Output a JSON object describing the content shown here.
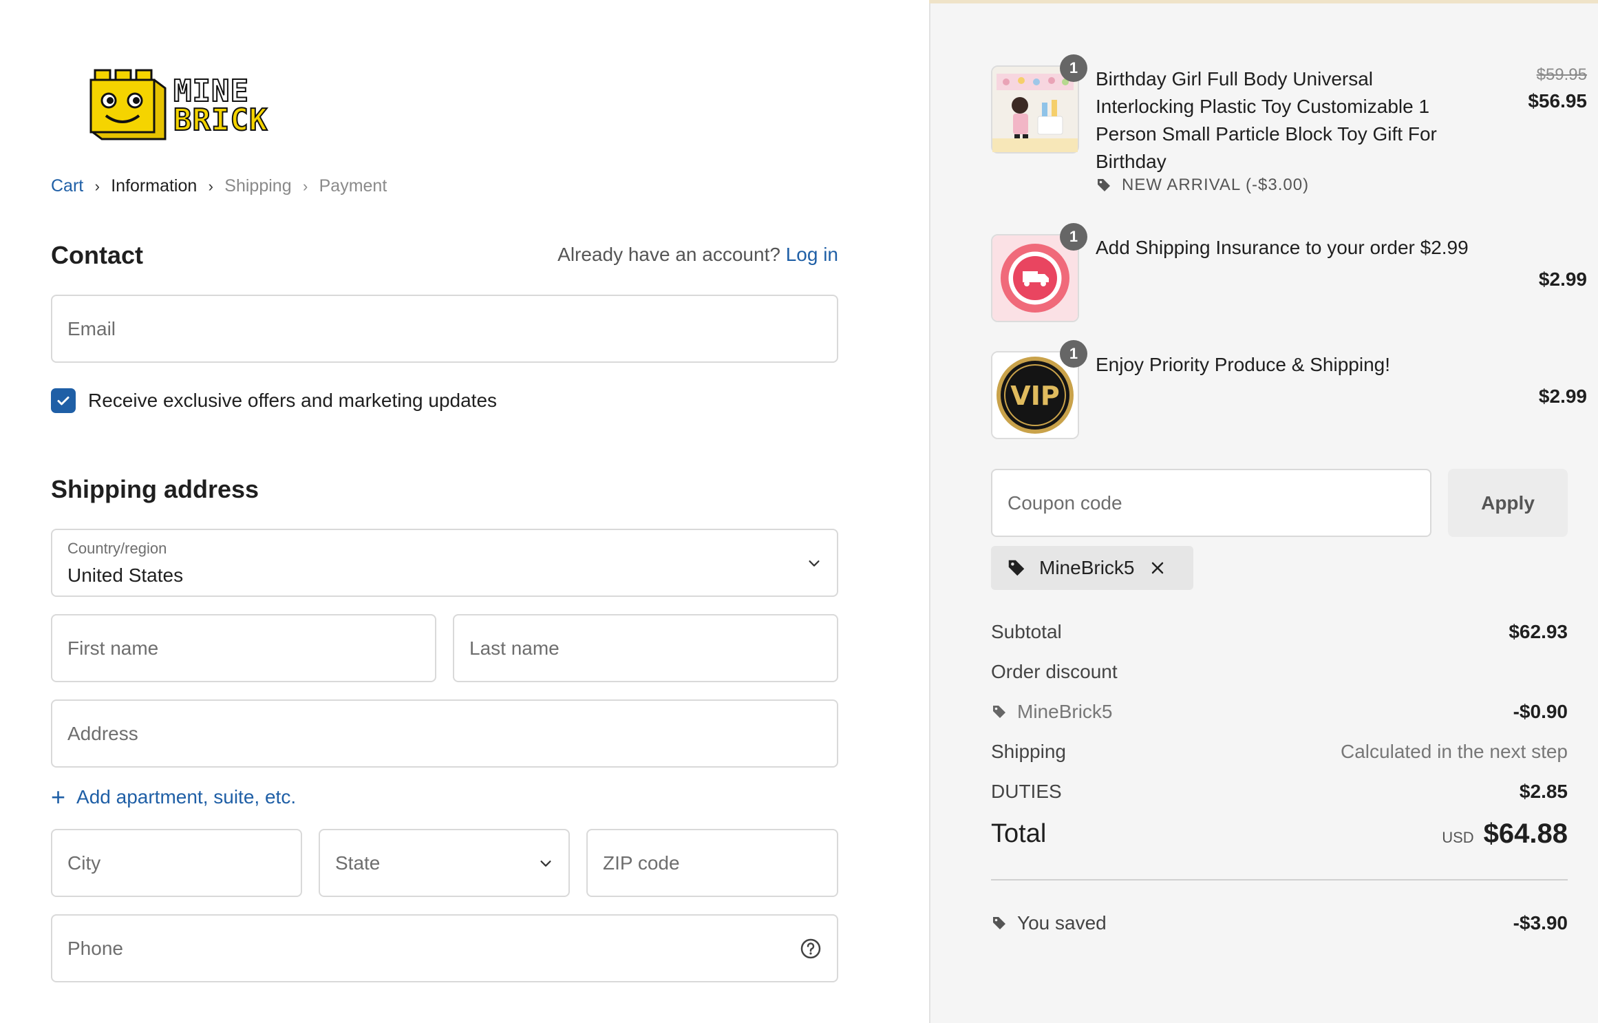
{
  "colors": {
    "accent": "#1f5fa6",
    "sidebar_bg": "#f5f5f5",
    "logo_yellow": "#f5d400"
  },
  "logo": {
    "line1": "MINE",
    "line2": "BRICK"
  },
  "breadcrumb": [
    "Cart",
    "Information",
    "Shipping",
    "Payment"
  ],
  "contact": {
    "title": "Contact",
    "account_prompt": "Already have an account?",
    "login_label": "Log in",
    "email_placeholder": "Email",
    "marketing_label": "Receive exclusive offers and marketing updates",
    "marketing_checked": true
  },
  "shipping": {
    "title": "Shipping address",
    "country_label": "Country/region",
    "country_value": "United States",
    "first_name_placeholder": "First name",
    "last_name_placeholder": "Last name",
    "address_placeholder": "Address",
    "add_apartment_label": "Add apartment, suite, etc.",
    "city_placeholder": "City",
    "state_placeholder": "State",
    "zip_placeholder": "ZIP code",
    "phone_placeholder": "Phone"
  },
  "order": {
    "items": [
      {
        "quantity": "1",
        "title": "Birthday Girl Full Body Universal Interlocking Plastic Toy Customizable 1 Person Small Particle Block Toy Gift For Birthday",
        "original_price": "$59.95",
        "price": "$56.95",
        "discount": "NEW ARRIVAL (-$3.00)",
        "icon": "birthday-toy-thumbnail"
      },
      {
        "quantity": "1",
        "title": "Add Shipping Insurance to your order $2.99",
        "price": "$2.99",
        "icon": "shipping-insurance-thumbnail"
      },
      {
        "quantity": "1",
        "title": "Enjoy Priority Produce & Shipping!",
        "price": "$2.99",
        "icon": "vip-thumbnail",
        "thumb_text": "VIP"
      }
    ],
    "coupon_placeholder": "Coupon code",
    "apply_label": "Apply",
    "applied_code": "MineBrick5",
    "subtotal_label": "Subtotal",
    "subtotal_value": "$62.93",
    "order_discount_label": "Order discount",
    "discount_code": "MineBrick5",
    "discount_value": "-$0.90",
    "shipping_label": "Shipping",
    "shipping_value": "Calculated in the next step",
    "duties_label": "DUTIES",
    "duties_value": "$2.85",
    "total_label": "Total",
    "currency": "USD",
    "total_value": "$64.88",
    "saved_label": "You saved",
    "saved_value": "-$3.90"
  }
}
